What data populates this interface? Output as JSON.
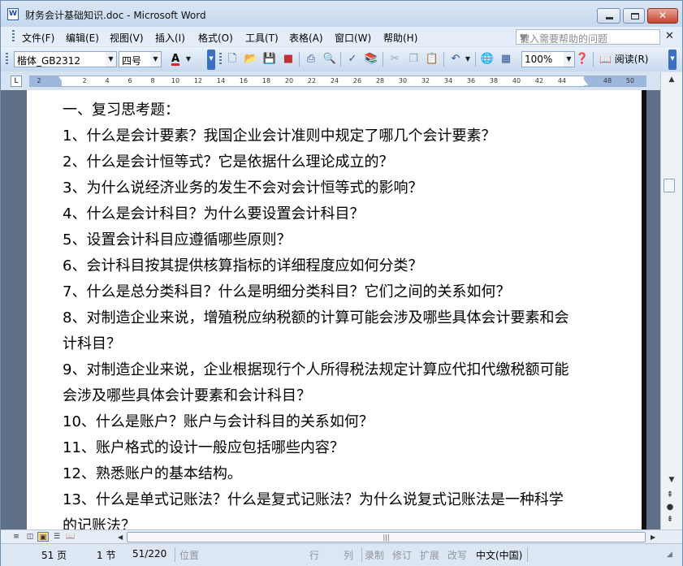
{
  "window": {
    "title": "财务会计基础知识.doc - Microsoft Word",
    "app_icon": "W"
  },
  "menu": {
    "items": [
      "文件(F)",
      "编辑(E)",
      "视图(V)",
      "插入(I)",
      "格式(O)",
      "工具(T)",
      "表格(A)",
      "窗口(W)",
      "帮助(H)"
    ],
    "help_placeholder": "键入需要帮助的问题"
  },
  "toolbar": {
    "font": "楷体_GB2312",
    "size": "四号",
    "zoom": "100%",
    "read_label": "阅读(R)",
    "font_color_label": "A",
    "font_color": "#e02020"
  },
  "ruler": {
    "ticks": [
      "2",
      "2",
      "4",
      "6",
      "8",
      "10",
      "12",
      "14",
      "16",
      "18",
      "20",
      "22",
      "24",
      "26",
      "28",
      "30",
      "32",
      "34",
      "36",
      "38",
      "40",
      "42",
      "44",
      "",
      "48",
      "50"
    ],
    "corner": "L"
  },
  "document": {
    "lines": [
      "一、复习思考题：",
      "1、什么是会计要素？我国企业会计准则中规定了哪几个会计要素？",
      "2、什么是会计恒等式？它是依据什么理论成立的？",
      "3、为什么说经济业务的发生不会对会计恒等式的影响？",
      "4、什么是会计科目？为什么要设置会计科目？",
      "5、设置会计科目应遵循哪些原则？",
      "6、会计科目按其提供核算指标的详细程度应如何分类？",
      "7、什么是总分类科目？什么是明细分类科目？它们之间的关系如何？",
      "8、对制造企业来说，增殖税应纳税额的计算可能会涉及哪些具体会计要素和会",
      "计科目？",
      "9、对制造企业来说，企业根据现行个人所得税法规定计算应代扣代缴税额可能",
      "会涉及哪些具体会计要素和会计科目？",
      "10、什么是账户？账户与会计科目的关系如何？",
      "11、账户格式的设计一般应包括哪些内容？",
      "12、熟悉账户的基本结构。",
      "13、什么是单式记账法？什么是复式记账法？为什么说复式记账法是一种科学",
      "的记账法？"
    ]
  },
  "status": {
    "page": "51 页",
    "section": "1 节",
    "page_of": "51/220",
    "position": "位置",
    "line": "行",
    "column": "列",
    "rec": "录制",
    "trk": "修订",
    "ext": "扩展",
    "ovr": "改写",
    "language": "中文(中国)"
  },
  "hscroll_grip": "|||"
}
